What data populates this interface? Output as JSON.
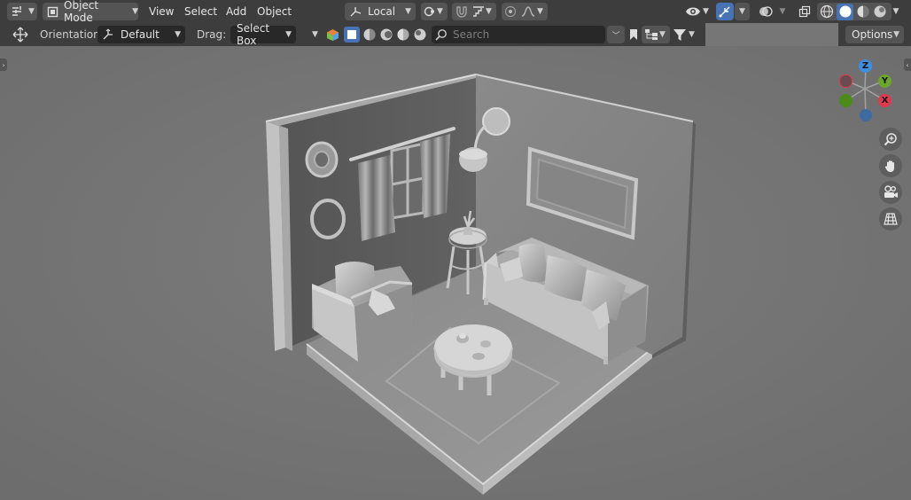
{
  "header": {
    "editor_type_icon": "viewport-editor-icon",
    "mode": "Object Mode",
    "menus": [
      "View",
      "Select",
      "Add",
      "Object"
    ],
    "transform_orientation": "Local",
    "options_label": "Options"
  },
  "tool_settings": {
    "orientation_label": "Orientation:",
    "orientation_value": "Default",
    "drag_label": "Drag:",
    "drag_value": "Select Box",
    "search_placeholder": "Search"
  },
  "gizmo": {
    "z": "Z",
    "y": "Y",
    "x": "X",
    "colors": {
      "x": "#e0384c",
      "y": "#6ba82a",
      "z": "#3b8ee0"
    }
  },
  "nav_buttons": [
    "zoom-icon",
    "hand-pan-icon",
    "camera-icon",
    "grid-perspective-icon"
  ],
  "accent": "#4772b3"
}
